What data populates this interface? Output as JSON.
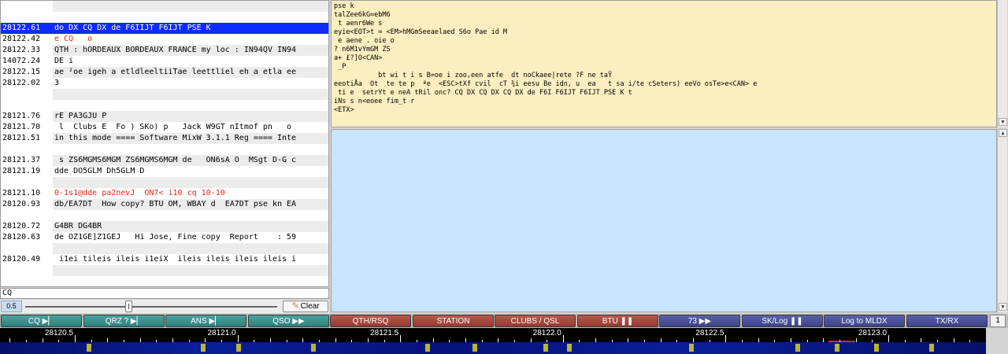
{
  "signal_list": [
    {
      "freq": "",
      "msg": "",
      "style": "alt"
    },
    {
      "freq": "",
      "msg": "",
      "style": ""
    },
    {
      "freq": "28122.61",
      "msg": "do DX CQ DX de F6IIJT F6IJT PSE K",
      "style": "selected"
    },
    {
      "freq": "28122.42",
      "msg": "e CQ   o",
      "style": "red"
    },
    {
      "freq": "28122.33",
      "msg": "QTH : hORDEAUX BORDEAUX FRANCE my loc : IN94QV IN94",
      "style": "alt"
    },
    {
      "freq": "14072.24",
      "msg": "DE i",
      "style": ""
    },
    {
      "freq": "28122.15",
      "msg": "ae ²oe igeh a etldleeltiiTae leettliel eh a etla ee",
      "style": "alt"
    },
    {
      "freq": "28122.02",
      "msg": "3",
      "style": ""
    },
    {
      "freq": "",
      "msg": "",
      "style": "alt"
    },
    {
      "freq": "",
      "msg": "",
      "style": ""
    },
    {
      "freq": "28121.76",
      "msg": "rE PA3GJU P",
      "style": "alt"
    },
    {
      "freq": "28121.70",
      "msg": " l  Clubs E  Fo ) SKo) p   Jack W9GT nItmof pn   o",
      "style": ""
    },
    {
      "freq": "28121.51",
      "msg": "in this mode ==== Software MixW 3.1.1 Reg ==== Inte",
      "style": "alt"
    },
    {
      "freq": "",
      "msg": "",
      "style": ""
    },
    {
      "freq": "28121.37",
      "msg": " s ZS6MGMS6MGM ZS6MGMS6MGM de   ON6sA O  MSgt D-G c",
      "style": "alt"
    },
    {
      "freq": "28121.19",
      "msg": "dde DO5GLM Dh5GLM D",
      "style": ""
    },
    {
      "freq": "",
      "msg": "",
      "style": "alt"
    },
    {
      "freq": "28121.10",
      "msg": "0-1s1@dde pa2nevJ  ON7< i10 cq 10-10",
      "style": "red"
    },
    {
      "freq": "28120.93",
      "msg": "db/EA7DT  How copy? BTU OM, WBAY d  EA7DT pse kn EA",
      "style": "alt"
    },
    {
      "freq": "",
      "msg": "",
      "style": ""
    },
    {
      "freq": "28120.72",
      "msg": "G4BR DG4BR",
      "style": "alt"
    },
    {
      "freq": "28120.63",
      "msg": "de OZ1GE]Z1GEJ   Hi Jose, Fine copy  Report    : 59",
      "style": ""
    },
    {
      "freq": "",
      "msg": "",
      "style": "alt"
    },
    {
      "freq": "28120.49",
      "msg": " i1ei tileis ileis i1eiX  ileis ileis ileis ileis i",
      "style": ""
    },
    {
      "freq": "",
      "msg": "",
      "style": "alt"
    }
  ],
  "filter": {
    "value": "CQ"
  },
  "slider": {
    "value": "0.5",
    "level": 0.41
  },
  "clear_label": "Clear",
  "rx_lines": [
    "pse k",
    "talZee6kG=ebM6",
    " t aenr6We s",
    "eyie<EOT>t = <EM>hMGmSeeaelaed S6o Pae id M",
    " e aene . oie o",
    "? n6M1vYmGM ZS",
    "a+ £?]O<CAN>",
    " _P",
    "           bt wi t i s B=oe i zoo,een atfe  dt noCkaee|rete ?F ne taŸ",
    "eeotiÅa  Ot  te te p  ªe  <ESC>tXf cvil  cT ¾i eesu Be idn, u  ea   t sa i/te cSeters) eeVo osTe>e<CAN> e",
    " ti e  setrYt e neA tRil onc? CQ DX CQ DX CQ DX de F6I F6IJT F6IJT PSE K t",
    "iNs s n<eoee fim_t r",
    "<ETX>"
  ],
  "macros": [
    {
      "label": "CQ ▶▏",
      "group": "teal"
    },
    {
      "label": "QRZ ? ▶▏",
      "group": "teal"
    },
    {
      "label": "ANS ▶▏",
      "group": "teal"
    },
    {
      "label": "QSO ▶▶",
      "group": "teal"
    },
    {
      "label": "QTH/RSQ",
      "group": "red"
    },
    {
      "label": "STATION",
      "group": "red"
    },
    {
      "label": "CLUBS / QSL",
      "group": "red"
    },
    {
      "label": "BTU ❚❚",
      "group": "red"
    },
    {
      "label": "73 ▶▶",
      "group": "blue"
    },
    {
      "label": "SK/Log ❚❚",
      "group": "blue"
    },
    {
      "label": "Log to MLDX",
      "group": "blue"
    },
    {
      "label": "TX/RX",
      "group": "blue"
    }
  ],
  "page_indicator": "1",
  "freq_scale": {
    "labels": [
      "28120.5",
      "28121.0",
      "28121.5",
      "28122.0",
      "28122.5",
      "28123.0"
    ],
    "start": 28120.27,
    "end": 28123.3
  },
  "colors": {
    "selected_row": "#0f2bff",
    "red_text": "#e8241c",
    "rx_background": "#fbeec0",
    "tx_background": "#c7e5fb"
  }
}
